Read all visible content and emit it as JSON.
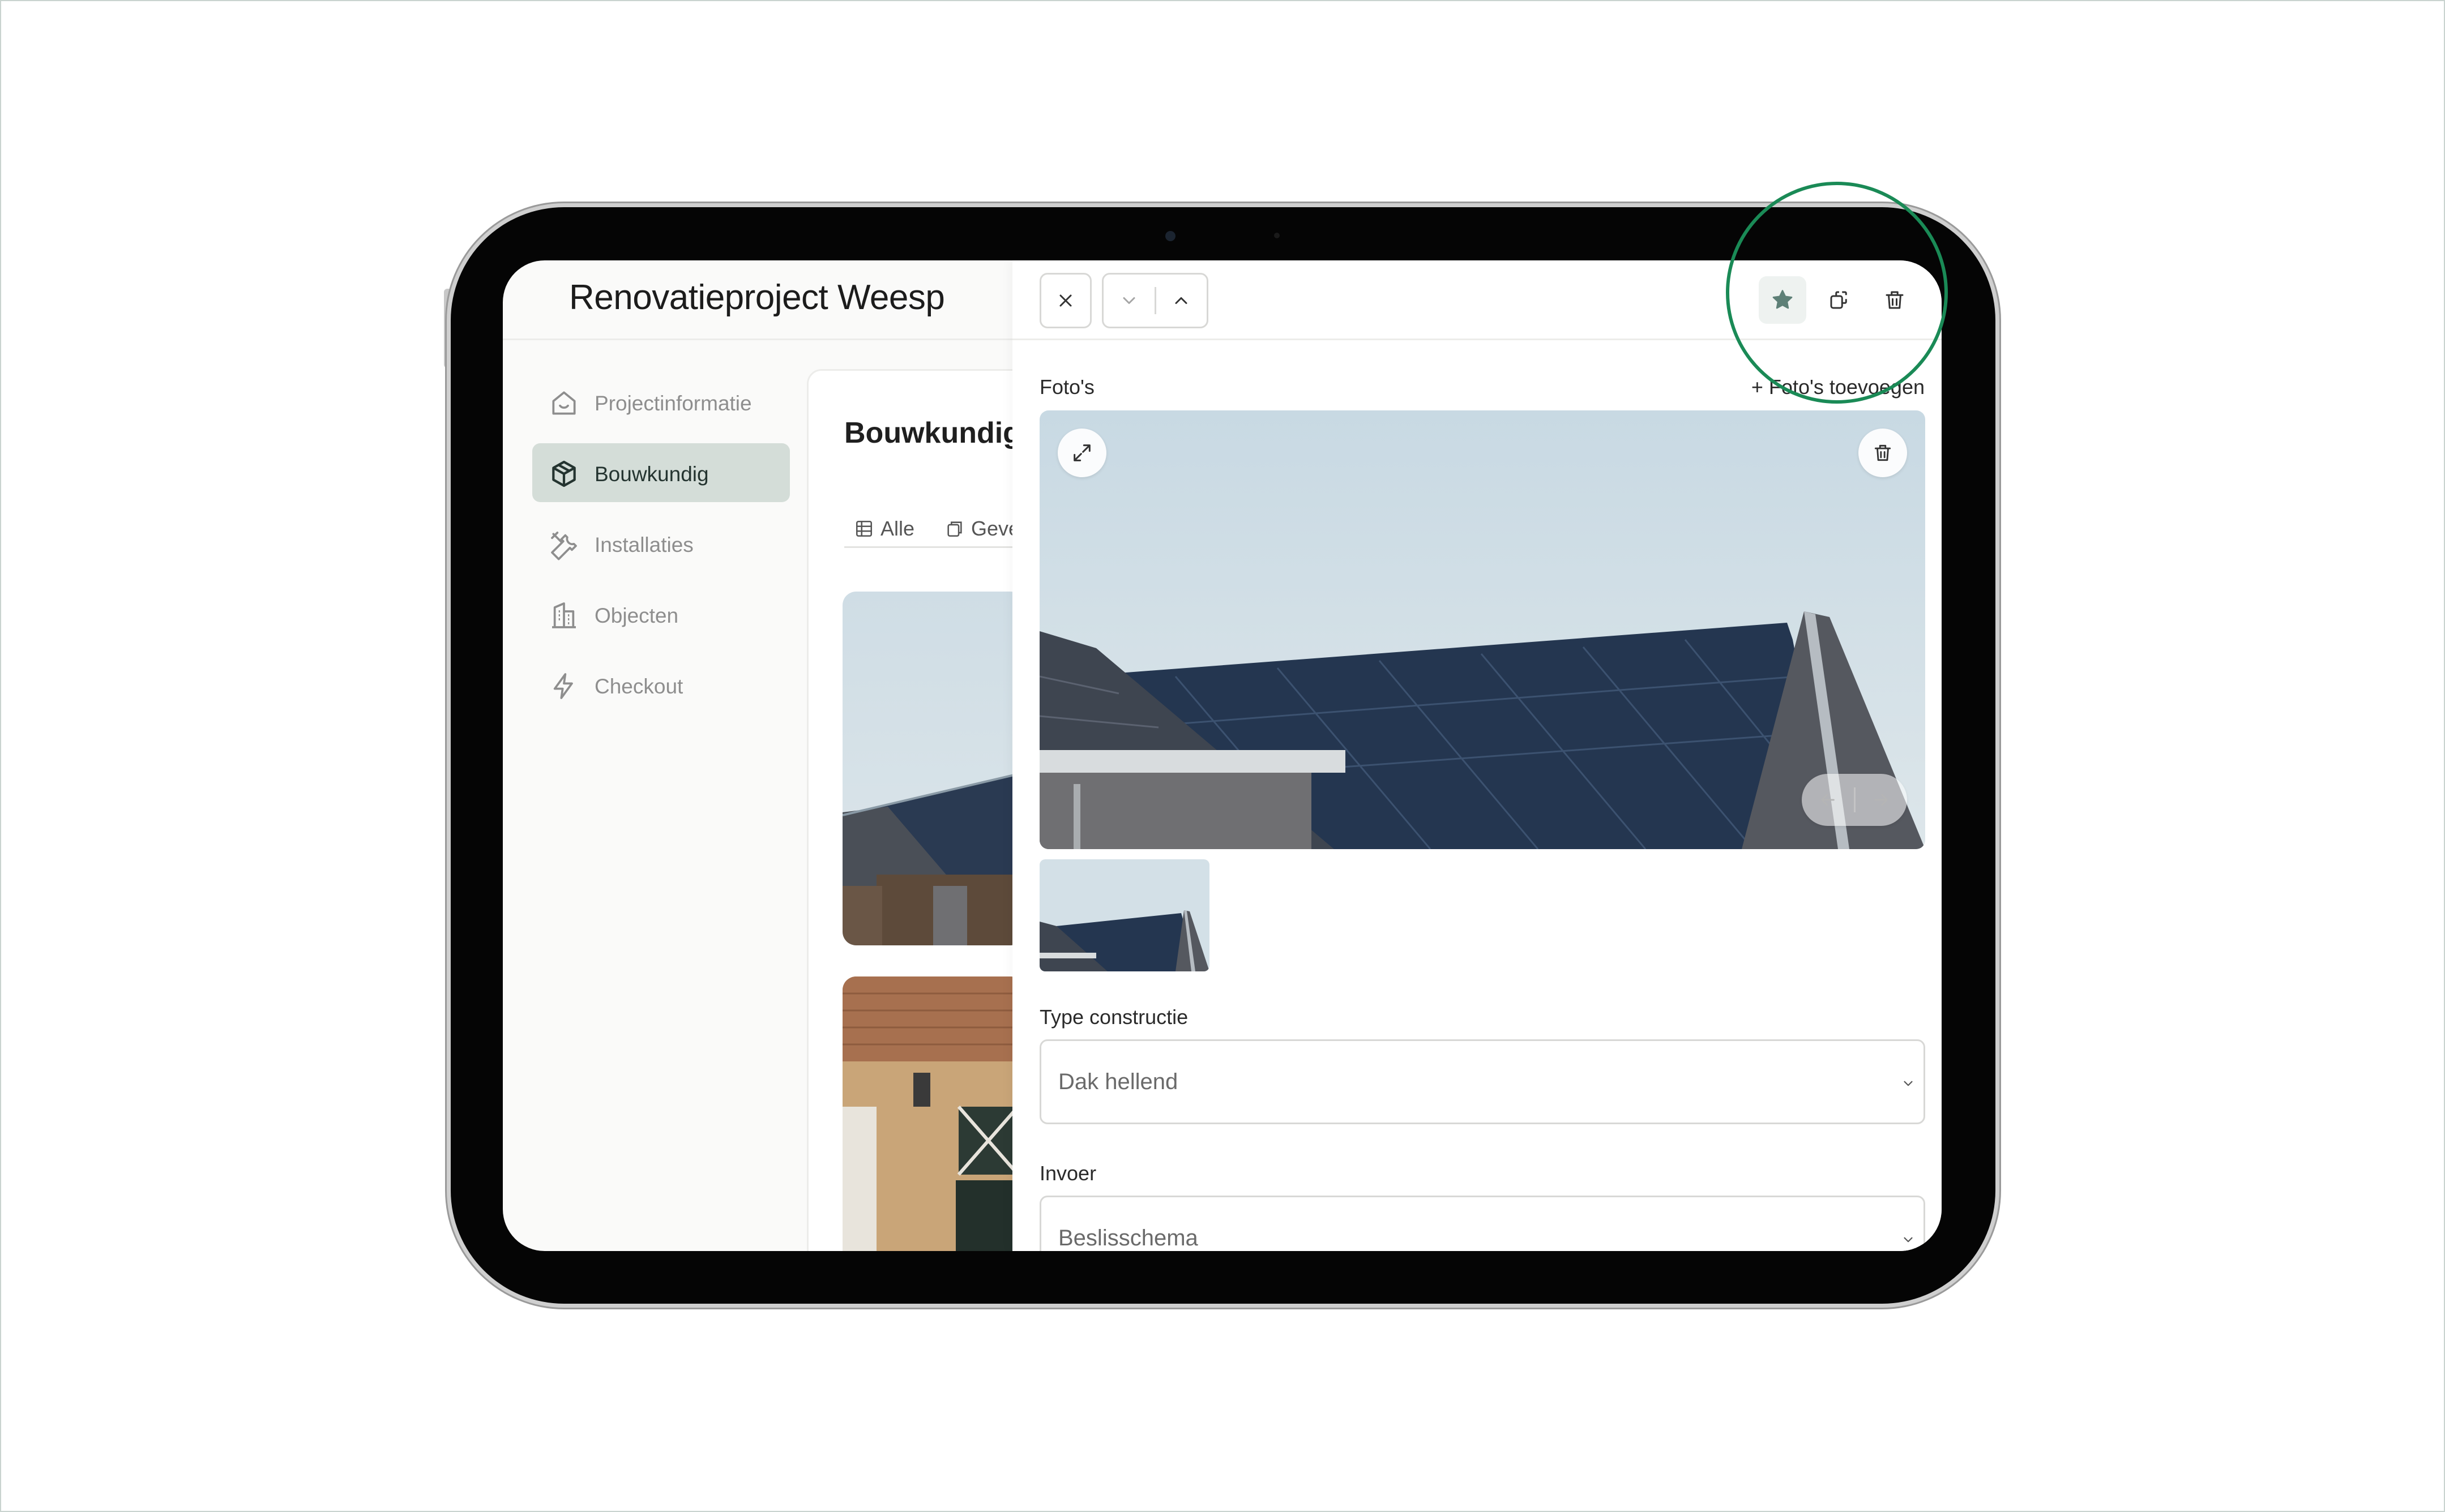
{
  "app": {
    "title": "Renovatieproject Weesp"
  },
  "sidebar": {
    "items": [
      {
        "label": "Projectinformatie",
        "icon": "house-icon",
        "active": false
      },
      {
        "label": "Bouwkundig",
        "icon": "box-icon",
        "active": true
      },
      {
        "label": "Installaties",
        "icon": "tools-icon",
        "active": false
      },
      {
        "label": "Objecten",
        "icon": "building-icon",
        "active": false
      },
      {
        "label": "Checkout",
        "icon": "lightning-icon",
        "active": false
      }
    ]
  },
  "card": {
    "title": "Bouwkundig",
    "tabs": [
      {
        "label": "Alle",
        "icon": "grid-icon"
      },
      {
        "label": "Geve",
        "icon": "copy-icon"
      }
    ]
  },
  "panel": {
    "header": {
      "close_icon": "close-icon",
      "down_icon": "chevron-down-icon",
      "up_icon": "chevron-up-icon",
      "favorite_icon": "star-icon",
      "duplicate_icon": "duplicate-icon",
      "delete_icon": "trash-icon"
    },
    "photos": {
      "label": "Foto's",
      "add_label": "+ Foto's toevoegen"
    },
    "fields": [
      {
        "label": "Type constructie",
        "value": "Dak hellend"
      },
      {
        "label": "Invoer",
        "value": "Beslisschema"
      }
    ]
  },
  "colors": {
    "accent": "#5e8077",
    "active_nav": "#d4ddd8",
    "highlight_ring": "#1a8a56"
  }
}
